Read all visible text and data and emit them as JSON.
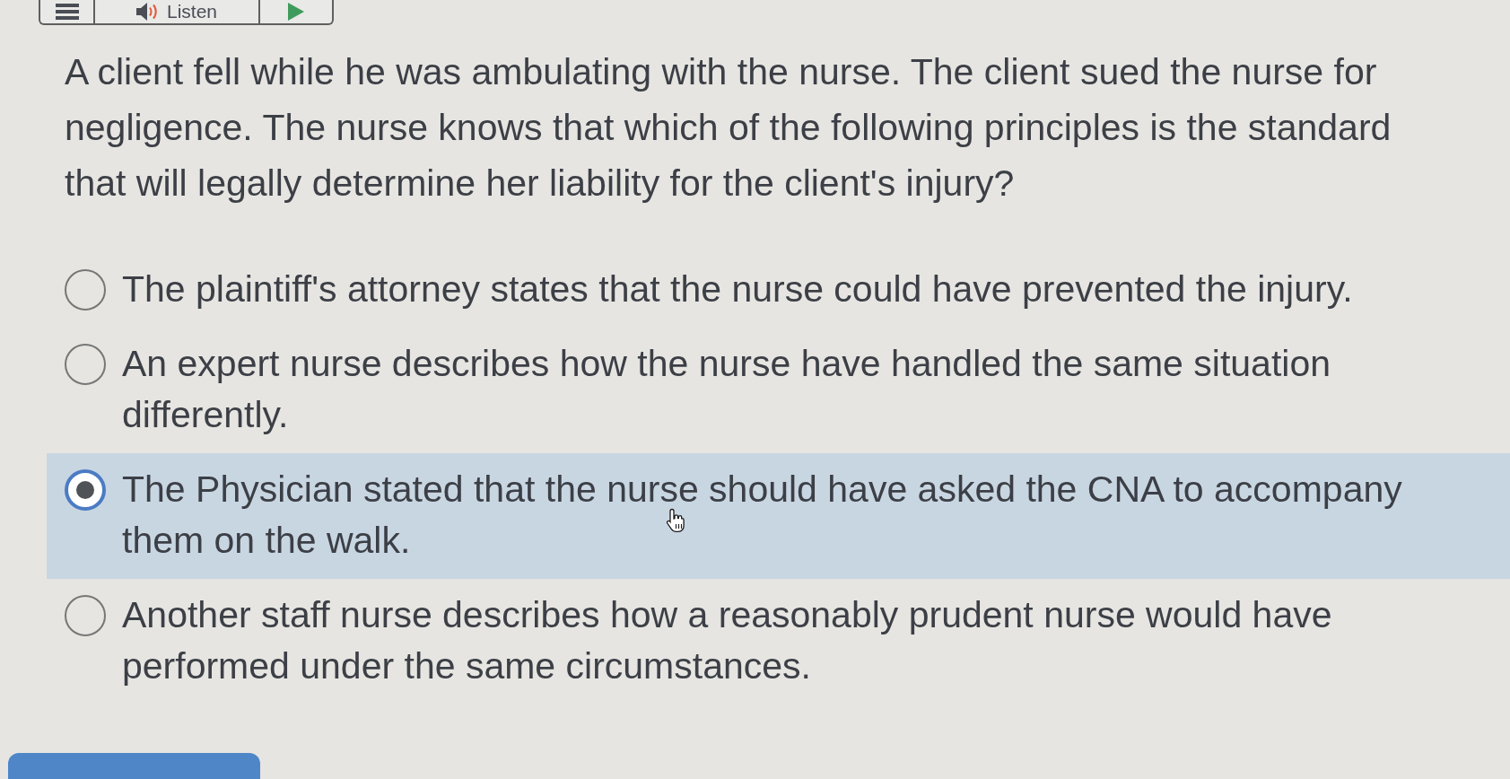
{
  "toolbar": {
    "buttons": [
      {
        "kind": "menu"
      },
      {
        "kind": "listen",
        "label": "Listen"
      },
      {
        "kind": "play"
      }
    ]
  },
  "question": {
    "text": "A client fell while he was ambulating with the nurse. The client sued the nurse for negligence. The nurse knows that which of the following principles is the standard that will legally determine her liability for the client's injury?"
  },
  "options": [
    {
      "text": "The plaintiff's attorney states that the nurse could have prevented the injury.",
      "selected": false
    },
    {
      "text": "An expert nurse describes how the nurse have handled the same situation differently.",
      "selected": false
    },
    {
      "text": "The Physician stated that the nurse should have asked the CNA to accompany them on the walk.",
      "selected": true
    },
    {
      "text": "Another staff nurse describes how a reasonably prudent nurse would have performed under the same circumstances.",
      "selected": false
    }
  ]
}
